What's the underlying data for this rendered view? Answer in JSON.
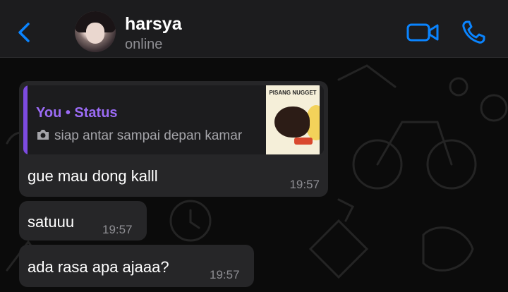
{
  "header": {
    "contact_name": "harsya",
    "presence": "online",
    "accent_color": "#0a84ff",
    "icons": [
      "chevron-left-icon",
      "avatar",
      "video-camera-icon",
      "phone-icon"
    ]
  },
  "messages": [
    {
      "direction": "incoming",
      "reply": {
        "author": "You • Status",
        "snippet": "siap antar sampai depan kamar",
        "snippet_icon": "camera-icon",
        "thumbnail_title": "PISANG NUGGET"
      },
      "text": "gue mau dong kalll",
      "time": "19:57"
    },
    {
      "direction": "incoming",
      "text": "satuuu",
      "time": "19:57"
    },
    {
      "direction": "incoming",
      "text": "ada rasa apa ajaaa?",
      "time": "19:57"
    }
  ],
  "colors": {
    "header_bg": "#1c1c1e",
    "bubble_bg": "#262628",
    "quote_accent": "#7d4be0",
    "quote_title": "#9b6bf5",
    "muted_text": "#8e8e93"
  }
}
